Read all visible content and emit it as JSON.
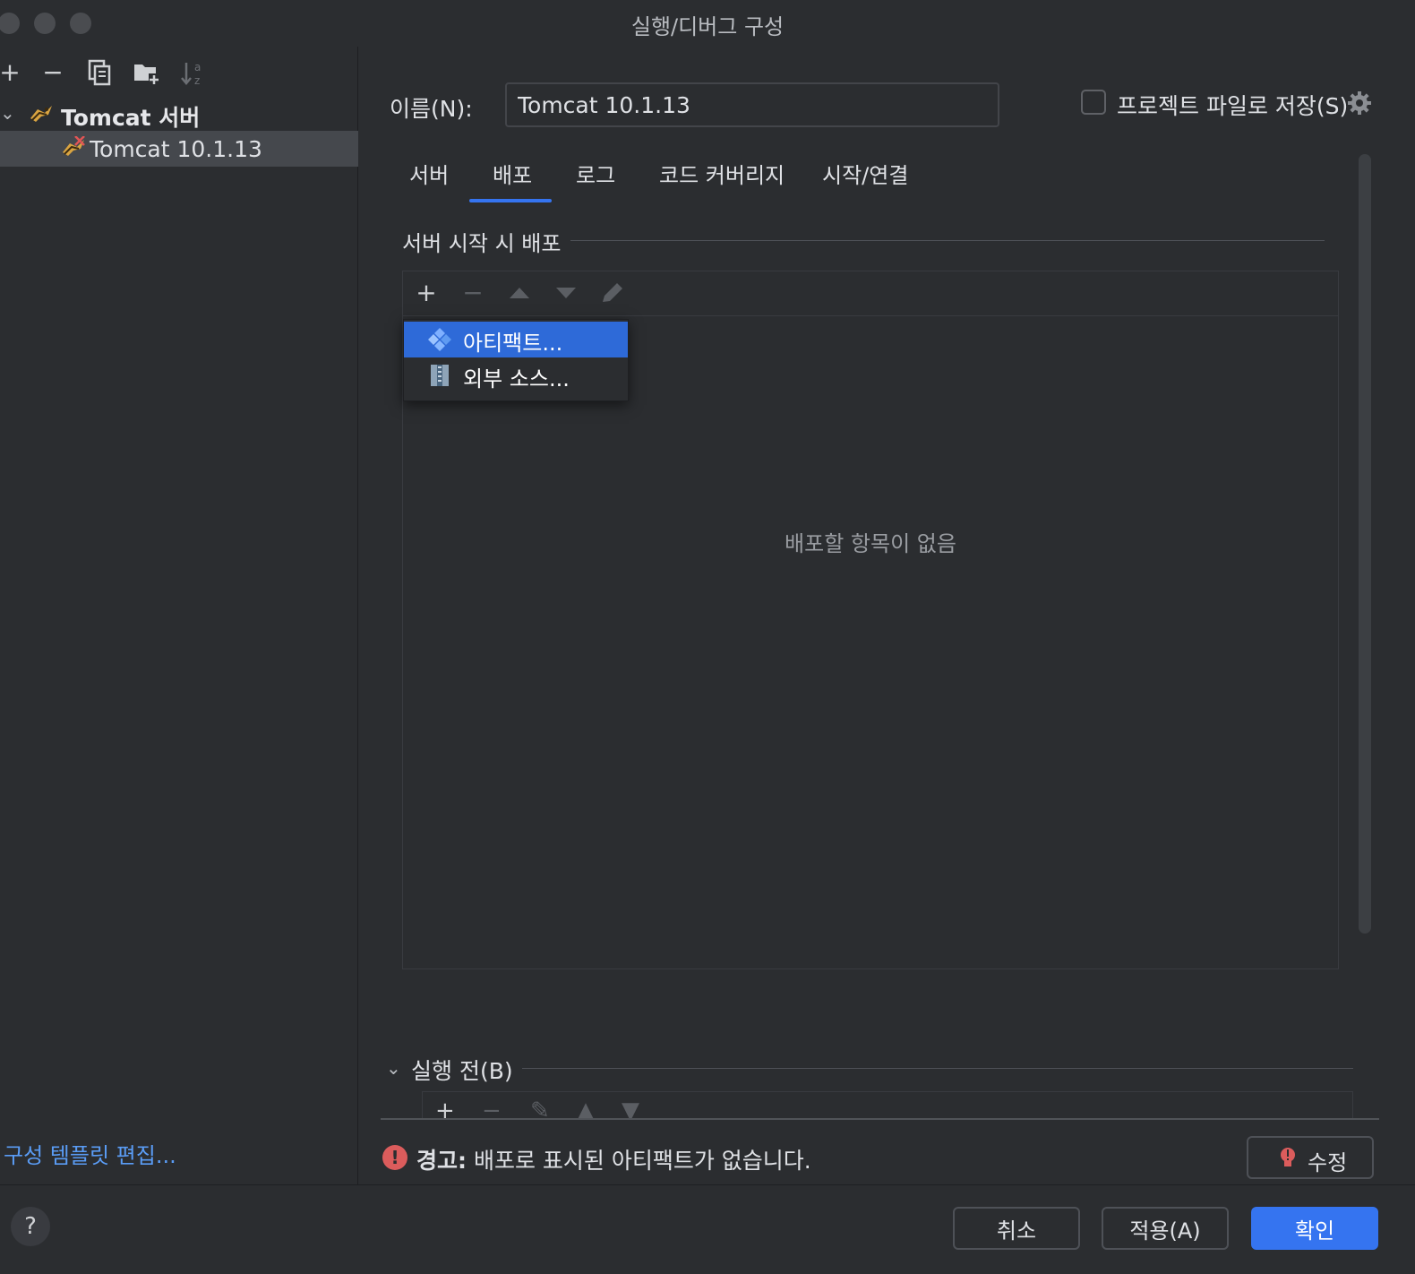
{
  "window": {
    "title": "실행/디버그 구성"
  },
  "left_pane": {
    "toolbar": [
      {
        "name": "add-config-icon",
        "glyph": "+"
      },
      {
        "name": "remove-config-icon",
        "glyph": "−"
      },
      {
        "name": "copy-config-icon",
        "glyph": "⧉"
      },
      {
        "name": "move-to-folder-icon",
        "glyph": "▆"
      },
      {
        "name": "sort-icon",
        "glyph": "⇅"
      }
    ],
    "tree": {
      "group_label": "Tomcat 서버",
      "item_label": "Tomcat 10.1.13"
    },
    "template_link": "구성 템플릿 편집..."
  },
  "right_pane": {
    "name_label": "이름(N):",
    "name_value": "Tomcat 10.1.13",
    "save_to_project_label": "프로젝트 파일로 저장(S)",
    "save_to_project_checked": false,
    "tabs": [
      "서버",
      "배포",
      "로그",
      "코드 커버리지",
      "시작/연결"
    ],
    "active_tab": "배포",
    "deploy_section_title": "서버 시작 시 배포",
    "deploy_empty_text": "배포할 항목이 없음",
    "popup_items": [
      "아티팩트...",
      "외부 소스..."
    ],
    "before_launch_title": "실행 전(B)",
    "warning_label": "경고:",
    "warning_message": " 배포로 표시된 아티팩트가 없습니다.",
    "fix_button": "수정"
  },
  "footer": {
    "help": "?",
    "cancel": "취소",
    "apply": "적용(A)",
    "ok": "확인"
  },
  "colors": {
    "background": "#2b2d30",
    "accent": "#3574f0",
    "link": "#5a9cf5",
    "warning": "#db5c5c"
  }
}
